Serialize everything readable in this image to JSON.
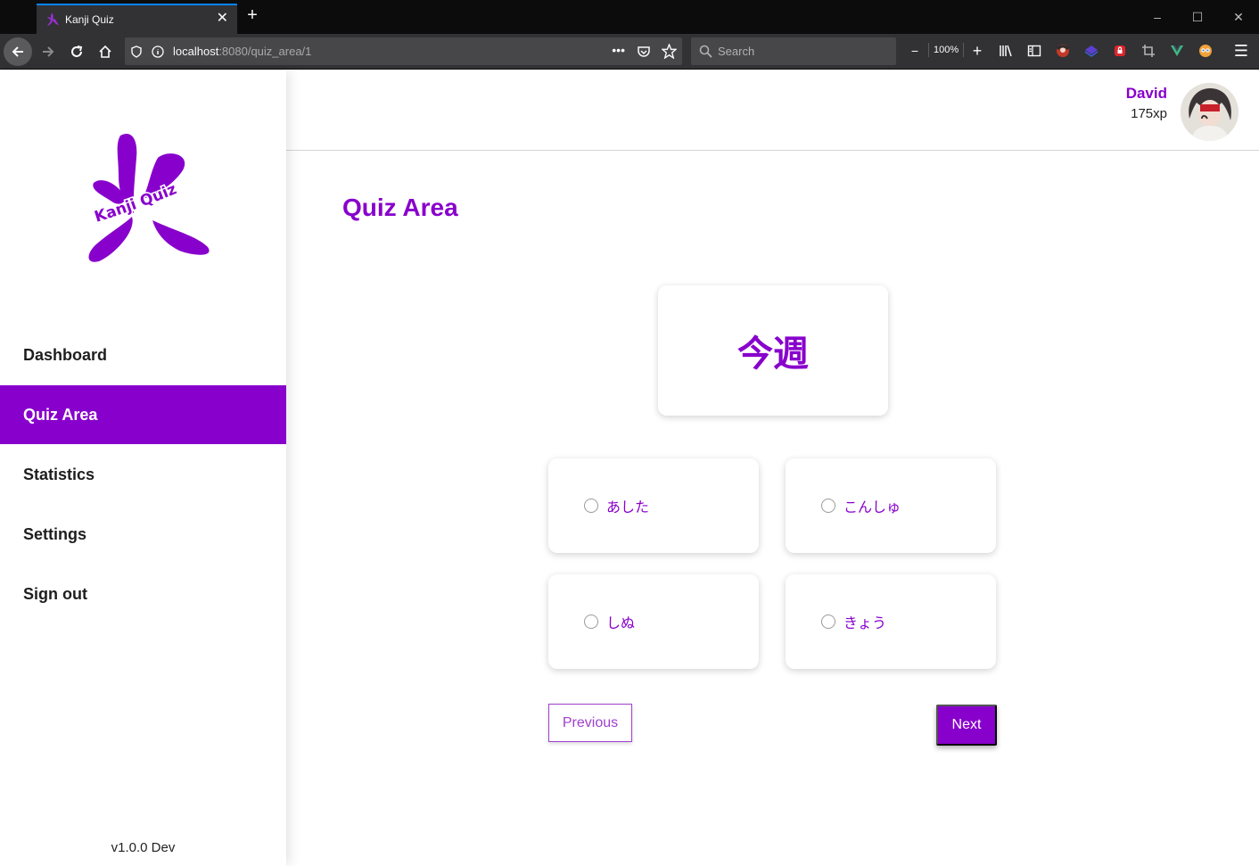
{
  "browser": {
    "tab_title": "Kanji Quiz",
    "url_host": "localhost",
    "url_rest": ":8080/quiz_area/1",
    "search_placeholder": "Search",
    "zoom_level": "100%",
    "accent_color": "#0a84ff"
  },
  "app": {
    "brand_color": "#8800cc",
    "logo_text": "Kanji Quiz",
    "nav_items": [
      {
        "label": "Dashboard",
        "active": false
      },
      {
        "label": "Quiz Area",
        "active": true
      },
      {
        "label": "Statistics",
        "active": false
      },
      {
        "label": "Settings",
        "active": false
      },
      {
        "label": "Sign out",
        "active": false
      }
    ],
    "version": "v1.0.0 Dev"
  },
  "user": {
    "name": "David",
    "xp": "175xp"
  },
  "quiz": {
    "page_title": "Quiz Area",
    "kanji": "今週",
    "options": [
      "あした",
      "こんしゅ",
      "しぬ",
      "きょう"
    ],
    "previous_label": "Previous",
    "next_label": "Next"
  }
}
